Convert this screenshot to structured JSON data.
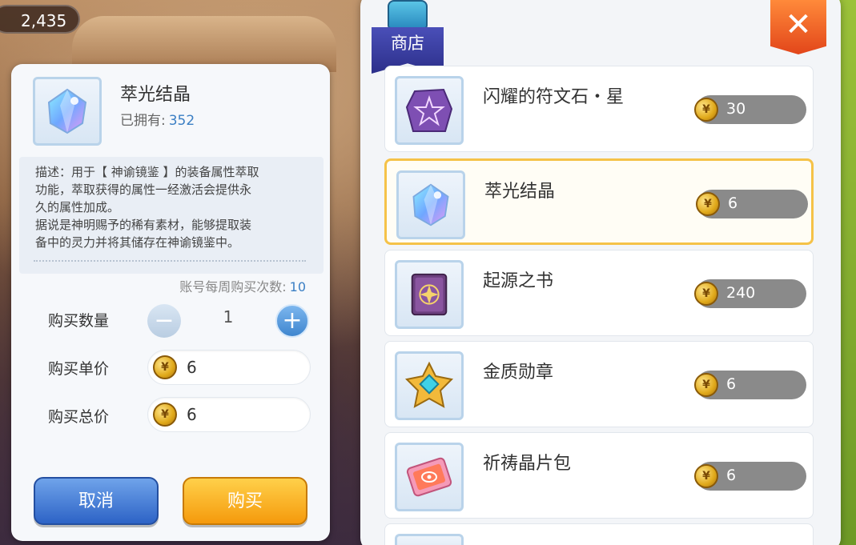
{
  "hud": {
    "coins": "2,435"
  },
  "detail": {
    "item_name": "萃光结晶",
    "owned_label": "已拥有:",
    "owned_count": "352",
    "description": [
      "描述：用于【 神谕镜鉴 】的装备属性萃取",
      "功能，萃取获得的属性一经激活会提供永",
      "久的属性加成。",
      "据说是神明赐予的稀有素材，能够提取装",
      "备中的灵力并将其储存在神谕镜鉴中。"
    ],
    "weekly_limit_label": "账号每周购买次数:",
    "weekly_limit_value": "10",
    "quantity_label": "购买数量",
    "quantity_value": "1",
    "unit_price_label": "购买单价",
    "unit_price_value": "6",
    "total_price_label": "购买总价",
    "total_price_value": "6",
    "cancel_label": "取消",
    "buy_label": "购买"
  },
  "shop": {
    "title": "商店",
    "close_symbol": "✕",
    "items": [
      {
        "name": "闪耀的符文石・星",
        "price": "30",
        "icon": "rune-stone-icon",
        "selected": false
      },
      {
        "name": "萃光结晶",
        "price": "6",
        "icon": "crystal-icon",
        "selected": true
      },
      {
        "name": "起源之书",
        "price": "240",
        "icon": "origin-book-icon",
        "selected": false
      },
      {
        "name": "金质勋章",
        "price": "6",
        "icon": "gold-medal-icon",
        "selected": false
      },
      {
        "name": "祈祷晶片包",
        "price": "6",
        "icon": "prayer-chip-pack-icon",
        "selected": false
      }
    ]
  },
  "colors": {
    "accent_blue": "#3b7fc4",
    "cancel_button": "#2d63c6",
    "buy_button": "#f59a0c",
    "selected_border": "#f5c248",
    "close_button": "#e2461a"
  }
}
